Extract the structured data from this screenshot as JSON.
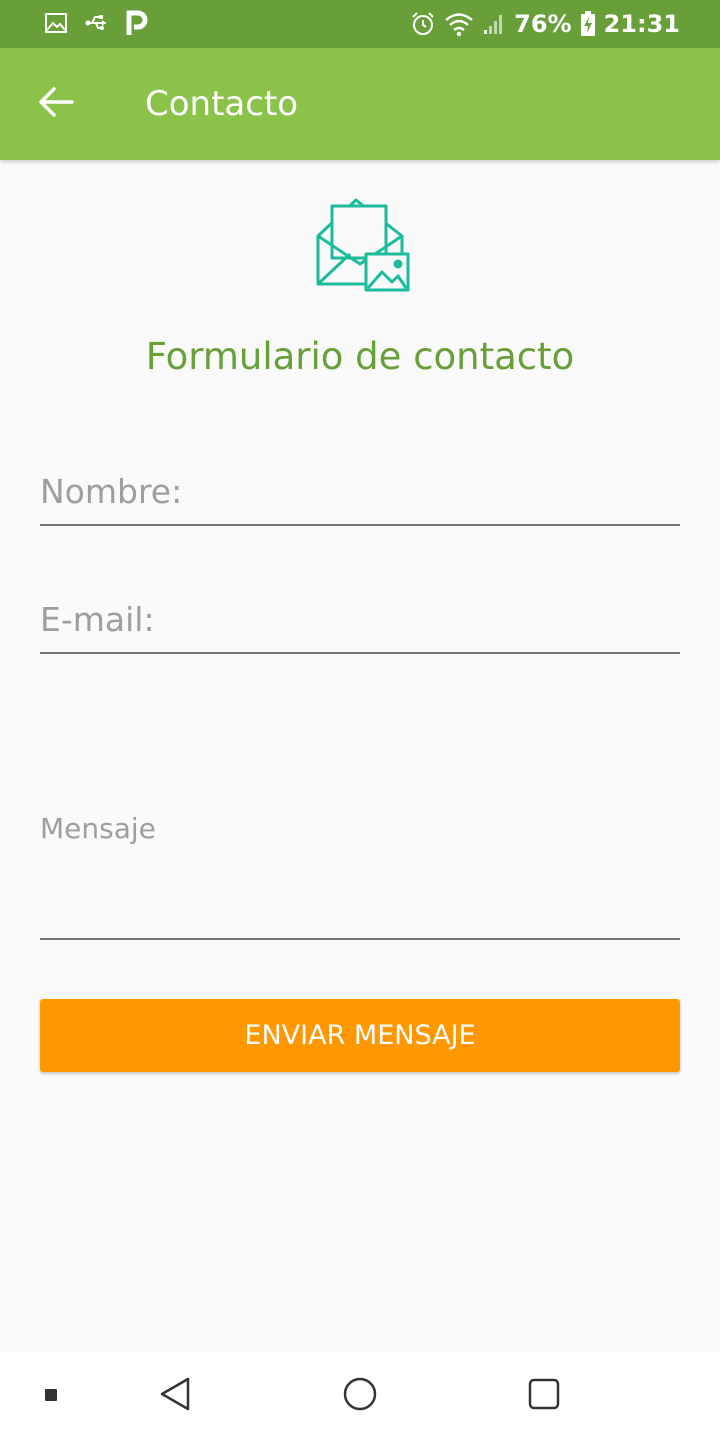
{
  "status_bar": {
    "battery_percent": "76%",
    "time": "21:31",
    "icons": [
      "image-icon",
      "usb-icon",
      "parking-icon",
      "alarm-icon",
      "wifi-icon",
      "signal-icon",
      "battery-charging-icon"
    ]
  },
  "app_bar": {
    "back_icon": "arrow-left-icon",
    "title": "Contacto"
  },
  "main": {
    "header_icon": "envelope-image-icon",
    "form_title": "Formulario de contacto",
    "fields": {
      "nombre_placeholder": "Nombre:",
      "email_placeholder": "E-mail:",
      "mensaje_placeholder": "Mensaje"
    },
    "submit_label": "ENVIAR MENSAJE"
  },
  "nav_bar": {
    "items": [
      "dot-icon",
      "back-triangle-icon",
      "home-circle-icon",
      "recents-square-icon"
    ]
  },
  "colors": {
    "status_bar": "#689f38",
    "app_bar": "#8bc34a",
    "title_green": "#689f38",
    "icon_teal": "#1abc9c",
    "button_orange": "#ff9800"
  }
}
